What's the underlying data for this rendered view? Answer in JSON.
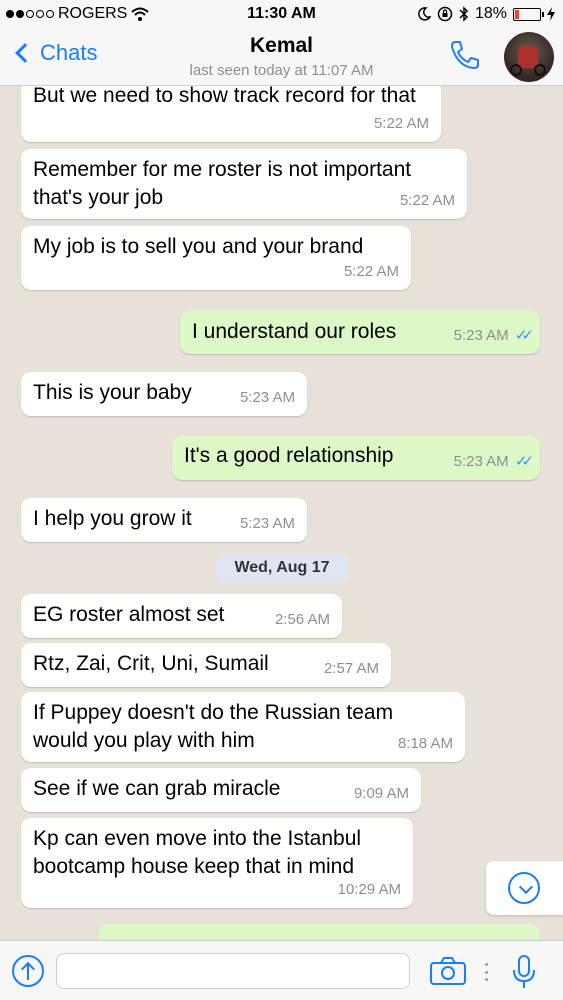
{
  "status_bar": {
    "carrier": "ROGERS",
    "time": "11:30 AM",
    "battery": "18%"
  },
  "header": {
    "back_label": "Chats",
    "contact_name": "Kemal",
    "last_seen": "last seen today at 11:07 AM"
  },
  "messages": [
    {
      "direction": "in",
      "text": "But we need to show track record for that",
      "time": "5:22 AM"
    },
    {
      "direction": "in",
      "text": "Remember for me roster is not important that's your job",
      "time": "5:22 AM"
    },
    {
      "direction": "in",
      "text": "My job is to sell you and your brand",
      "time": "5:22 AM"
    },
    {
      "direction": "out",
      "text": "I understand our roles",
      "time": "5:23 AM",
      "read": true
    },
    {
      "direction": "in",
      "text": "This is your baby",
      "time": "5:23 AM"
    },
    {
      "direction": "out",
      "text": "It's a good relationship",
      "time": "5:23 AM",
      "read": true
    },
    {
      "direction": "in",
      "text": "I help you grow it",
      "time": "5:23 AM"
    },
    {
      "direction": "in",
      "text": "EG roster almost set",
      "time": "2:56 AM"
    },
    {
      "direction": "in",
      "text": "Rtz, Zai, Crit, Uni, Sumail",
      "time": "2:57 AM"
    },
    {
      "direction": "in",
      "text": "If Puppey doesn't do the Russian team would you play with him",
      "time": "8:18 AM"
    },
    {
      "direction": "in",
      "text": "See if we can grab miracle",
      "time": "9:09 AM"
    },
    {
      "direction": "in",
      "text": "Kp can even move into the Istanbul bootcamp house keep that in mind",
      "time": "10:29 AM"
    }
  ],
  "date_separator": "Wed, Aug 17",
  "composer": {
    "placeholder": ""
  },
  "icons": {
    "back": "chevron-left-icon",
    "call": "phone-icon",
    "scroll_down": "chevron-down-circle-icon",
    "upload": "arrow-up-circle-icon",
    "camera": "camera-icon",
    "mic": "microphone-icon"
  },
  "colors": {
    "accent": "#1a7cff",
    "outgoing_bubble": "#dcf8c6",
    "incoming_bubble": "#ffffff",
    "read_ticks": "#3497f9",
    "chat_background": "#e7e1d8"
  }
}
